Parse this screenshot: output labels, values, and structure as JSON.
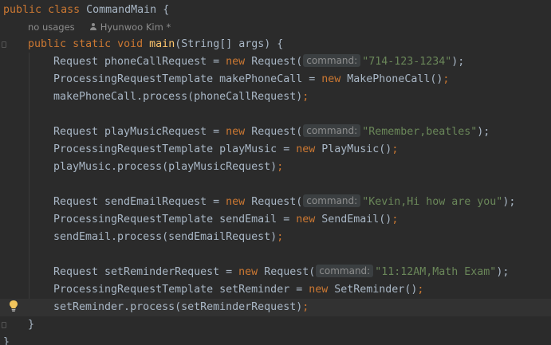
{
  "editor": {
    "class_line": {
      "kw_public": "public",
      "kw_class": "class",
      "class_name": "CommandMain",
      "brace": "{"
    },
    "meta": {
      "usages": "no usages",
      "author": "Hyunwoo Kim *"
    },
    "main_line": {
      "kw_public": "public",
      "kw_static": "static",
      "kw_void": "void",
      "method_name": "main",
      "params": "(String[] args) {"
    },
    "blocks": [
      {
        "req_decl": "Request phoneCallRequest = ",
        "req_new": "new",
        "req_ctor": " Request(",
        "hint": "command:",
        "req_arg": "\"714-123-1234\"",
        "req_end": ");",
        "tpl_decl": "ProcessingRequestTemplate makePhoneCall = ",
        "tpl_new": "new",
        "tpl_ctor": " MakePhoneCall()",
        "tpl_end": ";",
        "call": "makePhoneCall.process(phoneCallRequest)",
        "call_end": ";"
      },
      {
        "req_decl": "Request playMusicRequest = ",
        "req_new": "new",
        "req_ctor": " Request(",
        "hint": "command:",
        "req_arg": "\"Remember,beatles\"",
        "req_end": ");",
        "tpl_decl": "ProcessingRequestTemplate playMusic = ",
        "tpl_new": "new",
        "tpl_ctor": " PlayMusic()",
        "tpl_end": ";",
        "call": "playMusic.process(playMusicRequest)",
        "call_end": ";"
      },
      {
        "req_decl": "Request sendEmailRequest = ",
        "req_new": "new",
        "req_ctor": " Request(",
        "hint": "command:",
        "req_arg": "\"Kevin,Hi how are you\"",
        "req_end": ");",
        "tpl_decl": "ProcessingRequestTemplate sendEmail = ",
        "tpl_new": "new",
        "tpl_ctor": " SendEmail()",
        "tpl_end": ";",
        "call": "sendEmail.process(sendEmailRequest)",
        "call_end": ";"
      },
      {
        "req_decl": "Request setReminderRequest = ",
        "req_new": "new",
        "req_ctor": " Request(",
        "hint": "command:",
        "req_arg": "\"11:12AM,Math Exam\"",
        "req_end": ");",
        "tpl_decl": "ProcessingRequestTemplate setReminder = ",
        "tpl_new": "new",
        "tpl_ctor": " SetReminder()",
        "tpl_end": ";",
        "call": "setReminder.process(setReminderRequest)",
        "call_end": ";"
      }
    ],
    "method_close": "}",
    "class_close": "}",
    "colors": {
      "background": "#2b2b2b",
      "keyword": "#cc7832",
      "method": "#ffc66d",
      "string": "#6a8759",
      "text": "#a9b7c6",
      "hint_bg": "#3b3f41",
      "current_line": "#323232",
      "bulb": "#f2c55c"
    },
    "icons": {
      "bulb": "lightbulb-icon",
      "author": "person-icon"
    }
  }
}
